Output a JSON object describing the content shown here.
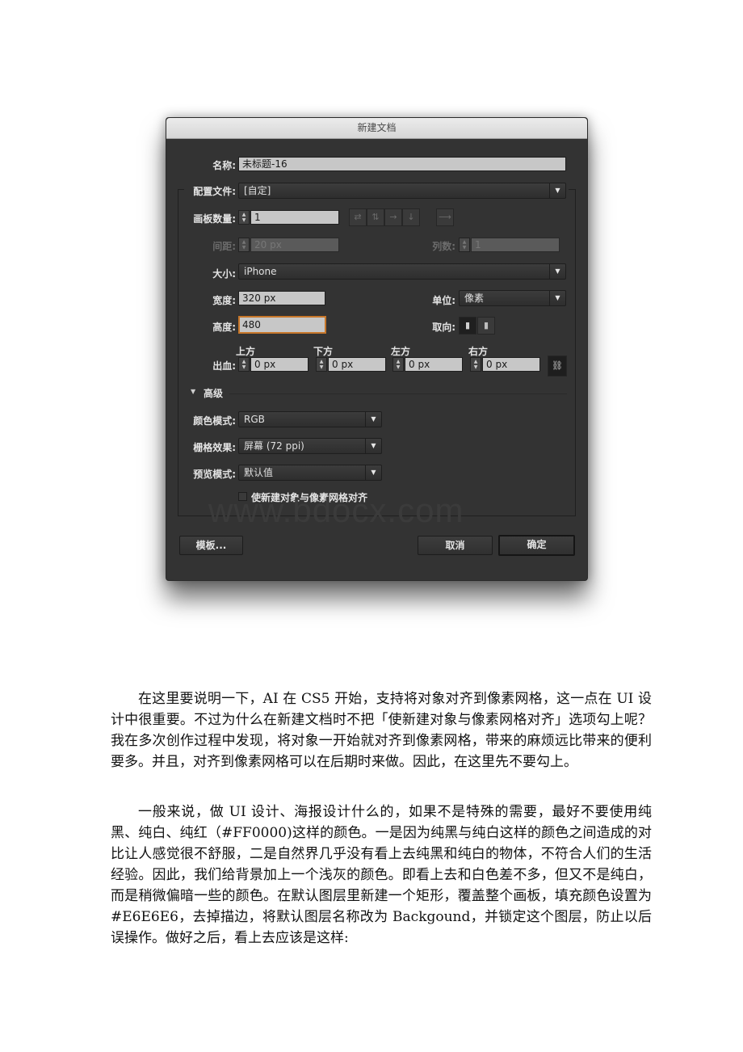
{
  "dialog": {
    "title": "新建文档",
    "name_label": "名称:",
    "name_value": "未标题-16",
    "profile_label": "配置文件:",
    "profile_value": "[自定]",
    "artboards_label": "画板数量:",
    "artboards_value": "1",
    "spacing_label": "间距:",
    "spacing_value": "20 px",
    "columns_label": "列数:",
    "columns_value": "1",
    "size_label": "大小:",
    "size_value": "iPhone",
    "width_label": "宽度:",
    "width_value": "320 px",
    "units_label": "单位:",
    "units_value": "像素",
    "height_label": "高度:",
    "height_value": "480",
    "orientation_label": "取向:",
    "bleed_label": "出血:",
    "bleed": [
      {
        "label": "上方",
        "value": "0 px"
      },
      {
        "label": "下方",
        "value": "0 px"
      },
      {
        "label": "左方",
        "value": "0 px"
      },
      {
        "label": "右方",
        "value": "0 px"
      }
    ],
    "advanced_label": "高级",
    "color_mode_label": "颜色模式:",
    "color_mode_value": "RGB",
    "raster_label": "栅格效果:",
    "raster_value": "屏幕 (72 ppi)",
    "preview_label": "预览模式:",
    "preview_value": "默认值",
    "align_pixel_label": "使新建对象与像素网格对齐",
    "align_pixel_checked": false,
    "templates_button": "模板...",
    "cancel_button": "取消",
    "ok_button": "确定",
    "watermark": "www.bdocx.com"
  },
  "article": {
    "paragraphs": [
      "在这里要说明一下，AI 在 CS5 开始，支持将对象对齐到像素网格，这一点在 UI 设计中很重要。不过为什么在新建文档时不把「使新建对象与像素网格对齐」选项勾上呢？我在多次创作过程中发现，将对象一开始就对齐到像素网格，带来的麻烦远比带来的便利要多。并且，对齐到像素网格可以在后期时来做。因此，在这里先不要勾上。",
      "一般来说，做 UI 设计、海报设计什么的，如果不是特殊的需要，最好不要使用纯黑、纯白、纯红（#FF0000)这样的颜色。一是因为纯黑与纯白这样的颜色之间造成的对比让人感觉很不舒服，二是自然界几乎没有看上去纯黑和纯白的物体，不符合人们的生活经验。因此，我们给背景加上一个浅灰的颜色。即看上去和白色差不多，但又不是纯白，而是稍微偏暗一些的颜色。在默认图层里新建一个矩形，覆盖整个画板，填充颜色设置为 #E6E6E6，去掉描边，将默认图层名称改为 Backgound，并锁定这个图层，防止以后误操作。做好之后，看上去应该是这样:"
    ]
  }
}
